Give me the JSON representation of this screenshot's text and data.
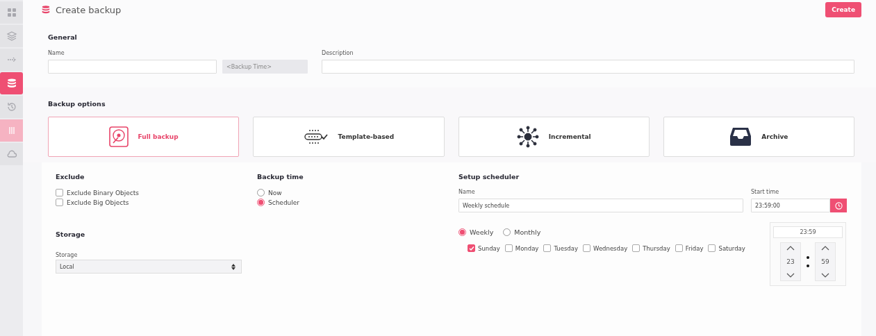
{
  "sidebar": {
    "items": [
      {
        "selected": false,
        "hover": false
      },
      {
        "selected": false,
        "hover": false
      },
      {
        "selected": false,
        "hover": false
      },
      {
        "selected": true,
        "hover": false
      },
      {
        "selected": false,
        "hover": false
      },
      {
        "selected": false,
        "hover": true
      },
      {
        "selected": false,
        "hover": false
      }
    ]
  },
  "header": {
    "title": "Create backup",
    "create_button": "Create"
  },
  "general": {
    "heading": "General",
    "name_label": "Name",
    "suffix_placeholder": "<Backup Time>",
    "description_label": "Description"
  },
  "backup_options": {
    "heading": "Backup options",
    "options": [
      {
        "label": "Full backup",
        "selected": true
      },
      {
        "label": "Template-based",
        "selected": false
      },
      {
        "label": "Incremental",
        "selected": false
      },
      {
        "label": "Archive",
        "selected": false
      }
    ]
  },
  "exclude": {
    "heading": "Exclude",
    "items": [
      {
        "label": "Exclude Binary Objects",
        "checked": false
      },
      {
        "label": "Exclude Big Objects",
        "checked": false
      }
    ]
  },
  "backup_time": {
    "heading": "Backup time",
    "options": [
      {
        "label": "Now",
        "selected": false
      },
      {
        "label": "Scheduler",
        "selected": true
      }
    ]
  },
  "storage": {
    "heading": "Storage",
    "label": "Storage",
    "value": "Local"
  },
  "scheduler": {
    "heading": "Setup scheduler",
    "name_label": "Name",
    "name_value": "Weekly schedule",
    "start_label": "Start time",
    "start_value": "23:59:00",
    "frequency": [
      {
        "label": "Weekly",
        "selected": true
      },
      {
        "label": "Monthly",
        "selected": false
      }
    ],
    "days": [
      {
        "label": "Sunday",
        "checked": true
      },
      {
        "label": "Monday",
        "checked": false
      },
      {
        "label": "Tuesday",
        "checked": false
      },
      {
        "label": "Wednesday",
        "checked": false
      },
      {
        "label": "Thursday",
        "checked": false
      },
      {
        "label": "Friday",
        "checked": false
      },
      {
        "label": "Saturday",
        "checked": false
      }
    ],
    "picker": {
      "display": "23:59",
      "hour": "23",
      "minute": "59"
    }
  }
}
